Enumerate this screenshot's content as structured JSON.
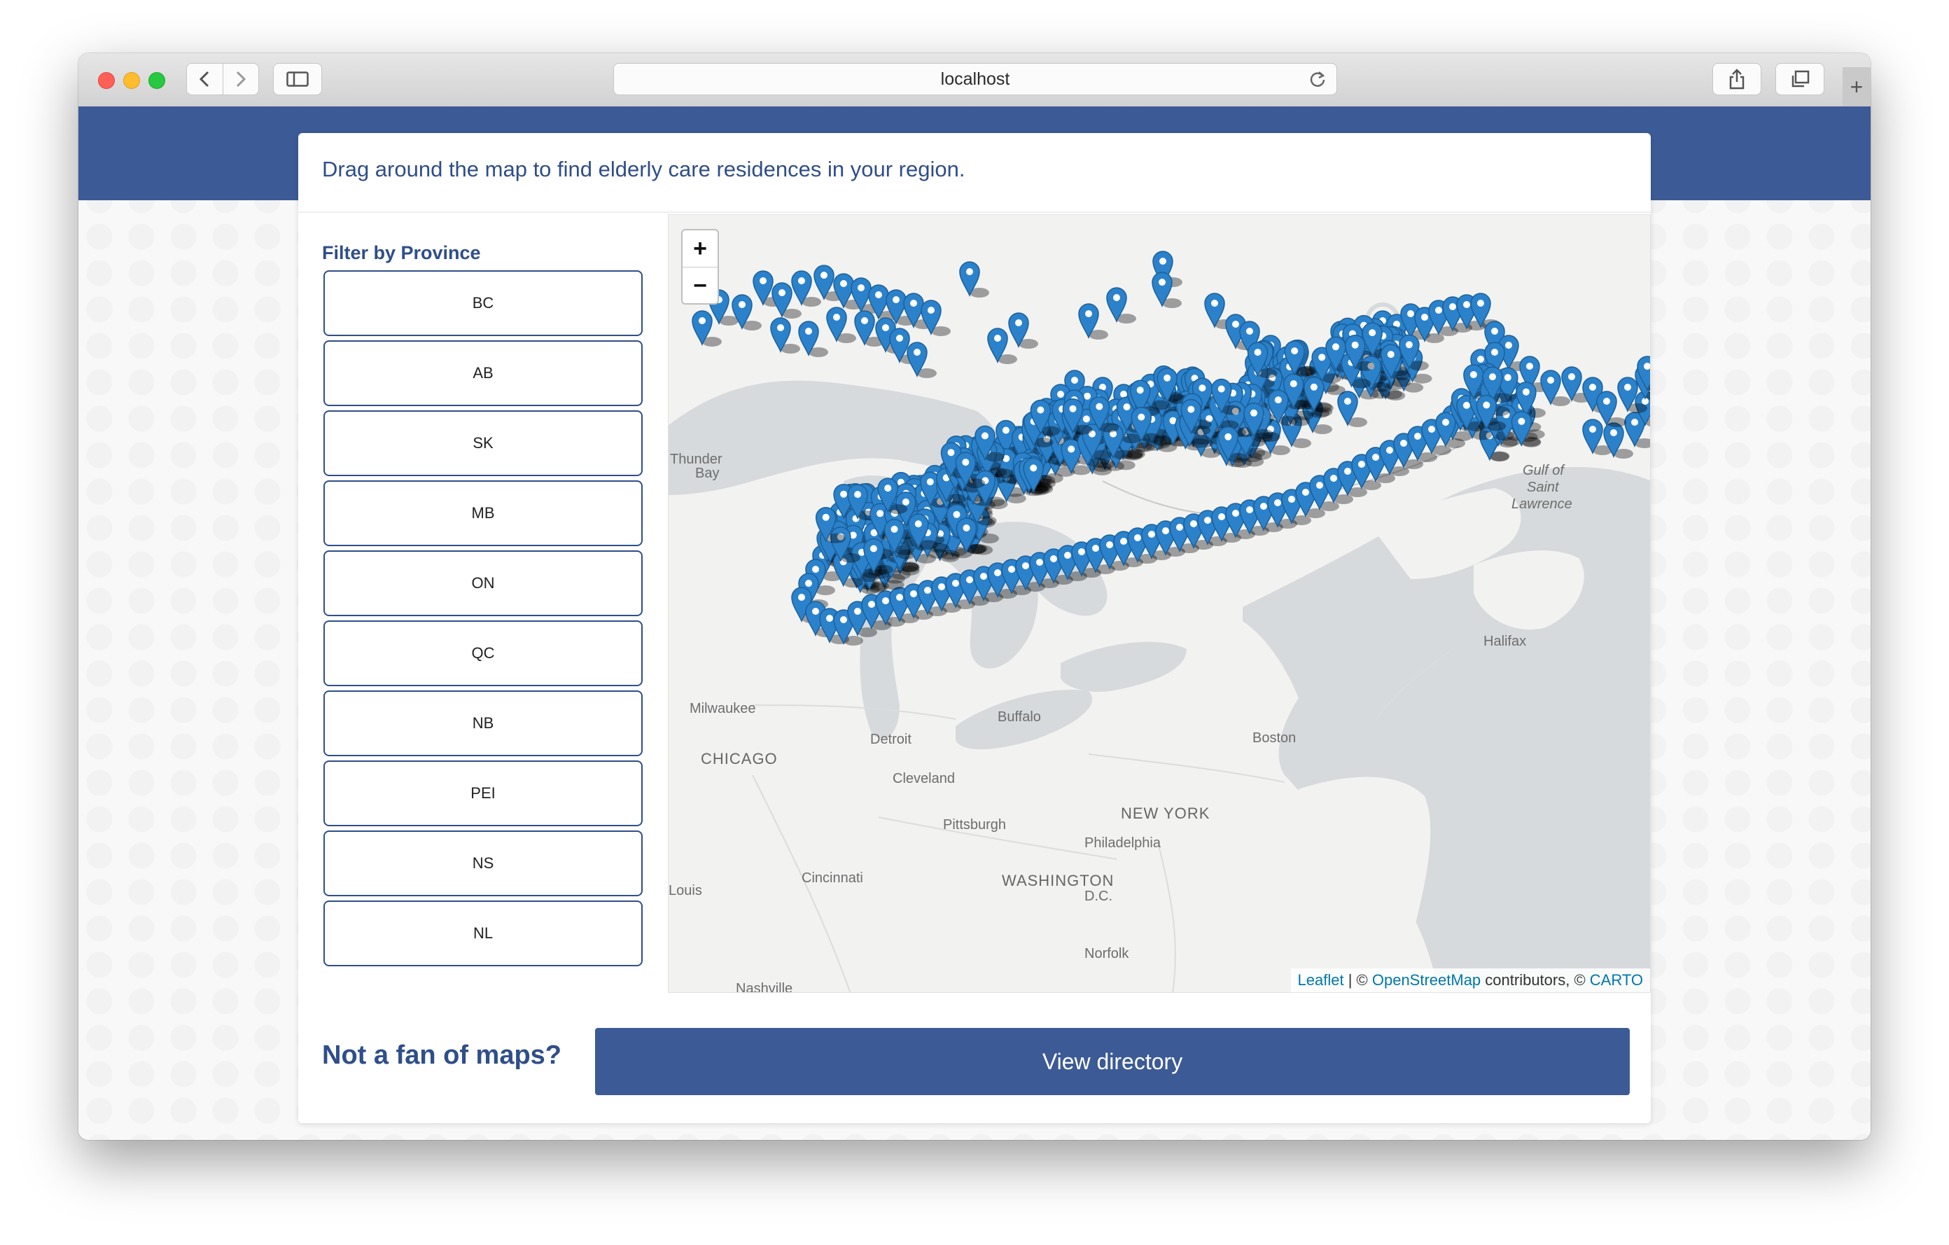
{
  "browser": {
    "address": "localhost"
  },
  "page": {
    "intro": "Drag around the map to find elderly care residences in your region.",
    "filter_title": "Filter by Province",
    "provinces": [
      "BC",
      "AB",
      "SK",
      "MB",
      "ON",
      "QC",
      "NB",
      "PEI",
      "NS",
      "NL"
    ],
    "cta_label": "Not a fan of maps?",
    "cta_button": "View directory"
  },
  "map": {
    "zoom_in": "+",
    "zoom_out": "−",
    "labels": {
      "thunder": "Thunder",
      "bay": "Bay",
      "milwaukee": "Milwaukee",
      "chicago": "CHICAGO",
      "detroit": "Detroit",
      "cleveland": "Cleveland",
      "pittsburgh": "Pittsburgh",
      "buffalo": "Buffalo",
      "boston": "Boston",
      "new_york": "NEW YORK",
      "philadelphia": "Philadelphia",
      "cincinnati": "Cincinnati",
      "washington": "WASHINGTON",
      "dc": "D.C.",
      "norfolk": "Norfolk",
      "gulf_of": "Gulf of",
      "saint": "Saint",
      "lawrence": "Lawrence",
      "halifax": "Halifax",
      "louis": "Louis",
      "nashville": "Nashville"
    },
    "attribution": {
      "leaflet": "Leaflet",
      "sep1": " | © ",
      "osm": "OpenStreetMap",
      "mid": " contributors, © ",
      "carto": "CARTO"
    },
    "marker_color": "#2b82cb"
  }
}
